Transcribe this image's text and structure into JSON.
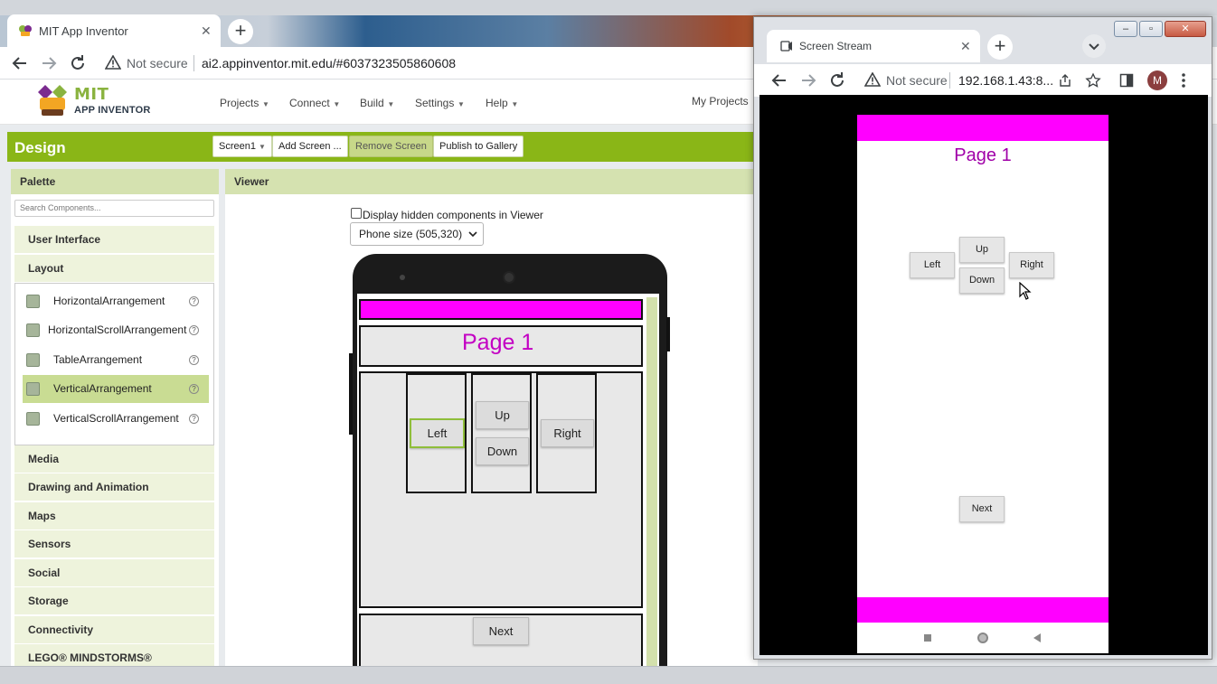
{
  "browser": {
    "tab_title": "MIT App Inventor",
    "tab_close": "✕",
    "new_tab": "+",
    "security_label": "Not secure",
    "url": "ai2.appinventor.mit.edu/#6037323505860608"
  },
  "app": {
    "logo_main": "MIT",
    "logo_sub": "APP INVENTOR",
    "menus": [
      "Projects",
      "Connect",
      "Build",
      "Settings",
      "Help"
    ],
    "my_projects": "My Projects",
    "design_title": "Design",
    "screen_select": "Screen1",
    "add_screen": "Add Screen ...",
    "remove_screen": "Remove Screen",
    "publish": "Publish to Gallery"
  },
  "palette": {
    "title": "Palette",
    "search_placeholder": "Search Components...",
    "categories_top": [
      "User Interface",
      "Layout"
    ],
    "layout_items": [
      "HorizontalArrangement",
      "HorizontalScrollArrangement",
      "TableArrangement",
      "VerticalArrangement",
      "VerticalScrollArrangement"
    ],
    "selected_item": "VerticalArrangement",
    "categories_bottom": [
      "Media",
      "Drawing and Animation",
      "Maps",
      "Sensors",
      "Social",
      "Storage",
      "Connectivity",
      "LEGO® MINDSTORMS®"
    ],
    "help_glyph": "?"
  },
  "viewer": {
    "title": "Viewer",
    "hidden_label": "Display hidden components in Viewer",
    "phone_size": "Phone size (505,320)",
    "page_title": "Page 1",
    "btn_left": "Left",
    "btn_up": "Up",
    "btn_down": "Down",
    "btn_right": "Right",
    "btn_next": "Next"
  },
  "popup": {
    "tab_title": "Screen Stream",
    "tab_close": "✕",
    "new_tab": "+",
    "security_label": "Not secure",
    "url": "192.168.1.43:8...",
    "avatar_letter": "M",
    "page_title": "Page 1",
    "btn_left": "Left",
    "btn_up": "Up",
    "btn_down": "Down",
    "btn_right": "Right",
    "btn_next": "Next"
  },
  "colors": {
    "design_green": "#8ab617",
    "magenta": "#ff00ff",
    "title_purple": "#c300c3"
  }
}
